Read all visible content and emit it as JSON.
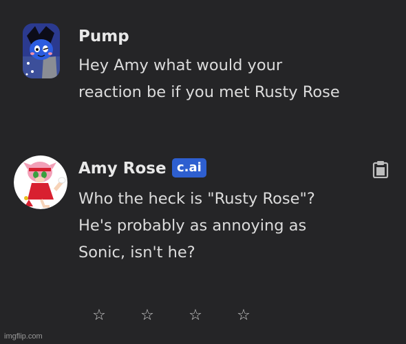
{
  "messages": [
    {
      "author": "Pump",
      "lines": [
        "Hey Amy what would your",
        "reaction be if you met Rusty Rose"
      ]
    },
    {
      "author": "Amy Rose",
      "badge": "c.ai",
      "lines": [
        "Who the heck is \"Rusty Rose\"?",
        "He's probably as annoying as",
        "Sonic, isn't he?"
      ]
    }
  ],
  "rating": {
    "stars": [
      "☆",
      "☆",
      "☆",
      "☆"
    ]
  },
  "watermark": "imgflip.com"
}
